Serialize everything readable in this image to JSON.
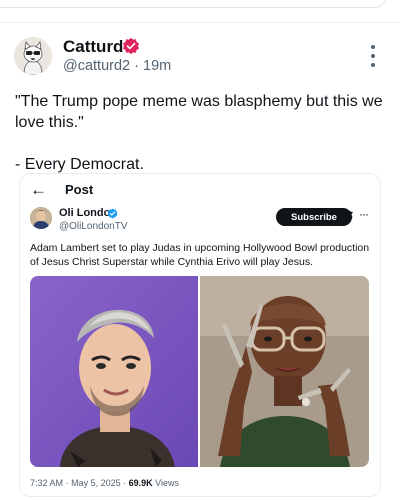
{
  "post": {
    "display_name": "Catturd",
    "handle": "@catturd2",
    "separator": "·",
    "time": "19m",
    "body": "\"The Trump pope meme was blasphemy but this we love this.\"\n\n- Every Democrat."
  },
  "quoted": {
    "header": {
      "back_icon": "←",
      "title": "Post"
    },
    "author": {
      "name": "Oli London",
      "handle": "@OliLondonTV"
    },
    "subscribe_label": "Subscribe",
    "ellipsis": "···",
    "text": "Adam Lambert set to play Judas in upcoming Hollywood Bowl production of Jesus Christ Superstar while Cynthia Erivo will play Jesus.",
    "meta": {
      "time": "7:32 AM",
      "separator": "·",
      "date": "May 5, 2025",
      "sep2": "·",
      "views": "69.9K",
      "views_label": "Views"
    }
  },
  "colors": {
    "verified_badge": "#e0245e",
    "blue_badge": "#1d9bf0",
    "text": "#0f1419",
    "secondary": "#536471"
  },
  "icons": [
    "back-arrow-icon",
    "verified-badge-icon",
    "more-vert-icon",
    "grok-icon",
    "ellipsis-icon"
  ]
}
